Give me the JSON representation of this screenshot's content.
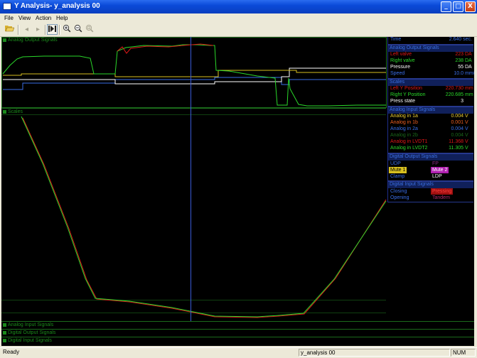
{
  "window": {
    "title": "Y Analysis- y_analysis 00",
    "controls": {
      "minimize": "_",
      "maximize": "□",
      "close": "X"
    }
  },
  "menu": [
    "File",
    "View",
    "Action",
    "Help"
  ],
  "toolbar": [
    "open-icon",
    "back-icon",
    "forward-icon",
    "play-to-end-icon",
    "zoom-in-icon",
    "zoom-out-icon",
    "zoom-fit-icon"
  ],
  "panels": {
    "analog_output": "Analog Output Signals",
    "scales": "Scales",
    "analog_input": "Analog Input Signals",
    "digital_output": "Digital Output Signals",
    "digital_input": "Digital Input Signals"
  },
  "info": {
    "time": {
      "label": "Time",
      "value": "2.640 sec."
    },
    "analog_output_header": "Analog Output Signals",
    "analog_output": [
      {
        "label": "Left valve",
        "value": "223",
        "unit": "DA",
        "color": "#e01818"
      },
      {
        "label": "Right valve",
        "value": "238",
        "unit": "DA",
        "color": "#2ad82a"
      },
      {
        "label": "Pressure",
        "value": "55",
        "unit": "DA",
        "color": "#ffffff"
      },
      {
        "label": "Speed",
        "value": "10.0",
        "unit": "mm/s",
        "color": "#3a6ee8"
      }
    ],
    "scales_header": "Scales",
    "scales": [
      {
        "label": "Left Y Position",
        "value": "220.730",
        "unit": "mm",
        "color": "#e01818"
      },
      {
        "label": "Right Y Position",
        "value": "220.685",
        "unit": "mm",
        "color": "#2ad82a"
      },
      {
        "label": "Press state",
        "value": "3",
        "unit": "",
        "color": "#ffffff"
      }
    ],
    "analog_input_header": "Analog Input Signals",
    "analog_input": [
      {
        "label": "Analog in 1a",
        "value": "0.004",
        "unit": "V",
        "color": "#f0d030"
      },
      {
        "label": "Analog in 1b",
        "value": "0.001",
        "unit": "V",
        "color": "#f06020"
      },
      {
        "label": "Analog in 2a",
        "value": "0.004",
        "unit": "V",
        "color": "#3a6ee8"
      },
      {
        "label": "Analog in 2b",
        "value": "0.004",
        "unit": "V",
        "color": "#1b6a1b"
      },
      {
        "label": "Analog in LVDT1",
        "value": "11.368",
        "unit": "V",
        "color": "#e01818"
      },
      {
        "label": "Analog in LVDT2",
        "value": "11.305",
        "unit": "V",
        "color": "#2ad82a"
      }
    ],
    "digital_output_header": "Digital Output Signals",
    "digital_output": [
      [
        {
          "text": "UDP",
          "fg": "#3a6ee8",
          "bg": "transparent"
        },
        {
          "text": "FP",
          "fg": "#8a2a8a",
          "bg": "transparent"
        }
      ],
      [
        {
          "text": "Mute 1",
          "fg": "#000000",
          "bg": "#d8c020"
        },
        {
          "text": "Mute 2",
          "fg": "#ffffff",
          "bg": "#b020b0"
        }
      ],
      [
        {
          "text": "Clamp",
          "fg": "#3a6ee8",
          "bg": "transparent"
        },
        {
          "text": "LDP",
          "fg": "#ffffff",
          "bg": "transparent"
        }
      ]
    ],
    "digital_input_header": "Digital Input Signals",
    "digital_input": [
      [
        {
          "text": "Closing",
          "fg": "#3a6ee8",
          "bg": "transparent"
        },
        {
          "text": "Pressing",
          "fg": "#ff4040",
          "bg": "#a01010"
        }
      ],
      [
        {
          "text": "Opening",
          "fg": "#3a6ee8",
          "bg": "transparent"
        },
        {
          "text": "Tandem",
          "fg": "#b02a6a",
          "bg": "transparent"
        }
      ]
    ]
  },
  "status": {
    "left": "Ready",
    "middle": "y_analysis 00",
    "right": "NUM"
  }
}
